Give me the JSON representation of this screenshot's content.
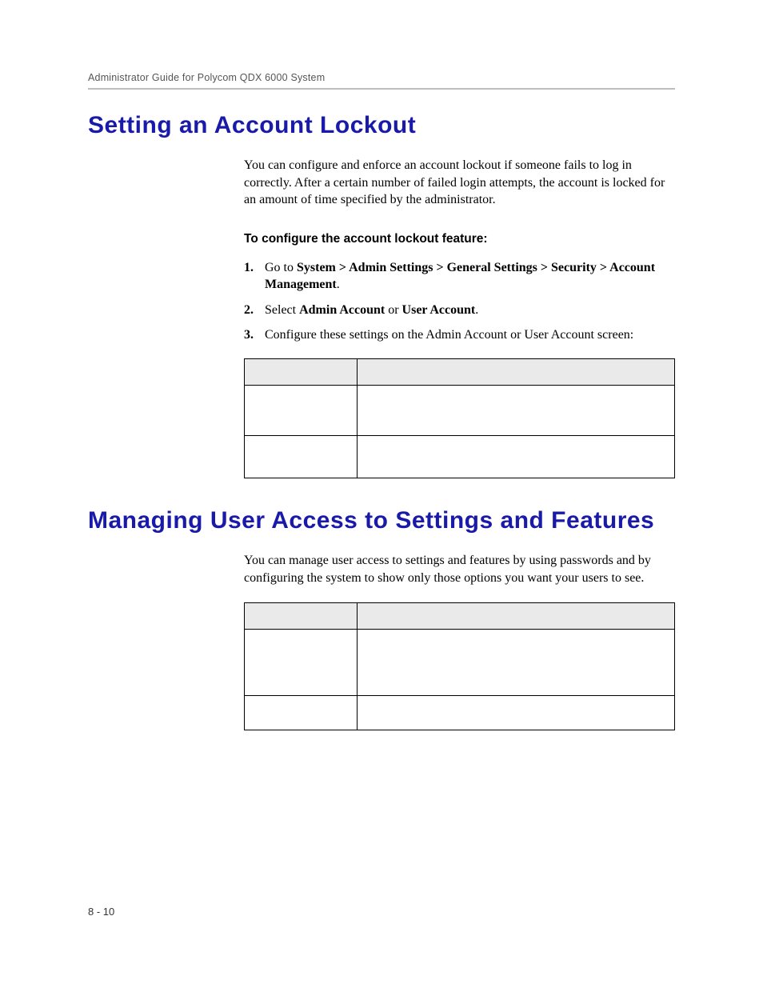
{
  "header": {
    "running": "Administrator Guide for Polycom QDX 6000 System"
  },
  "section1": {
    "title": "Setting an Account Lockout",
    "intro": "You can configure and enforce an account lockout if someone fails to log in correctly. After a certain number of failed login attempts, the account is locked for an amount of time specified by the administrator.",
    "subhead": "To configure the account lockout feature:",
    "steps": {
      "s1_prefix": "Go to ",
      "s1_bold": "System > Admin Settings > General Settings > Security > Account Management",
      "s1_suffix": ".",
      "s2_prefix": "Select ",
      "s2_bold_a": "Admin Account",
      "s2_mid": " or ",
      "s2_bold_b": "User Account",
      "s2_suffix": ".",
      "s3": "Configure these settings on the Admin Account or User Account screen:"
    }
  },
  "section2": {
    "title": "Managing User Access to Settings and Features",
    "intro": "You can manage user access to settings and features by using passwords and by configuring the system to show only those options you want your users to see."
  },
  "footer": {
    "pagenum": "8 - 10"
  }
}
